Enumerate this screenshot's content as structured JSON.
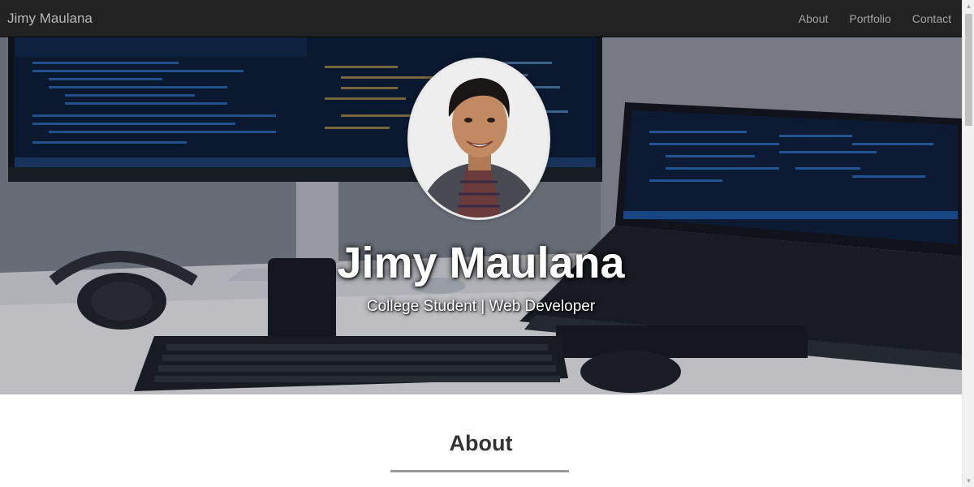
{
  "navbar": {
    "brand": "Jimy Maulana",
    "links": [
      {
        "label": "About"
      },
      {
        "label": "Portfolio"
      },
      {
        "label": "Contact"
      }
    ]
  },
  "hero": {
    "title": "Jimy Maulana",
    "subtitle": "College Student | Web Developer"
  },
  "about": {
    "heading": "About"
  },
  "colors": {
    "navbar_bg": "#222222",
    "nav_text": "#a5a5a5",
    "hero_text": "#ffffff",
    "heading_text": "#333333",
    "rule": "#9a9a9a"
  }
}
